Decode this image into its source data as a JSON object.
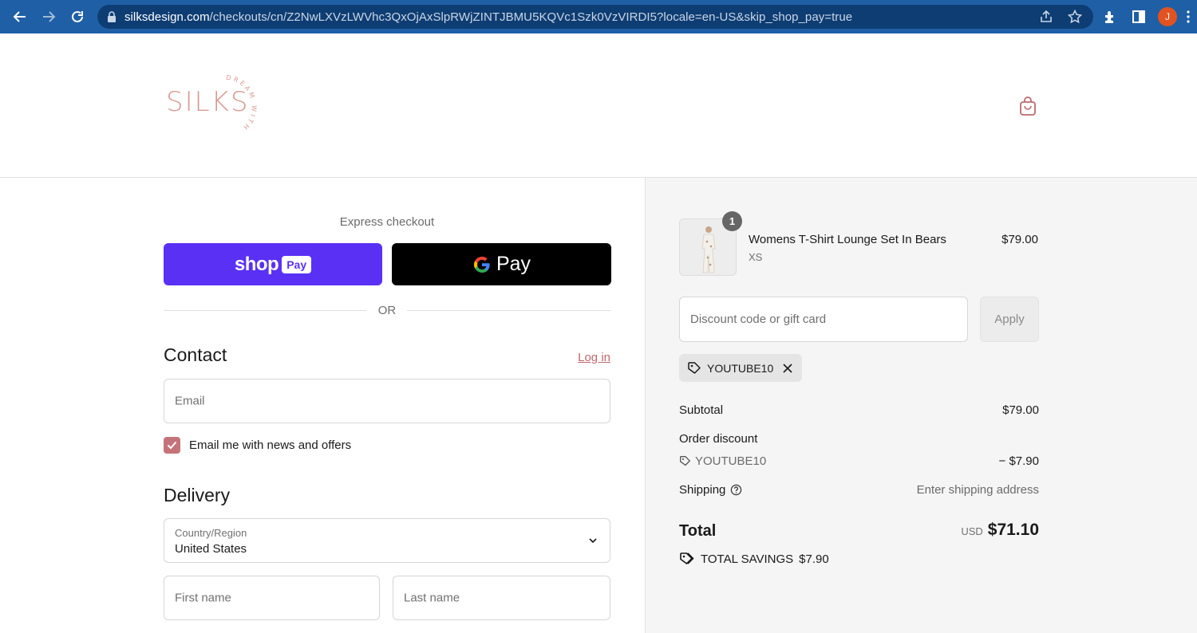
{
  "browser": {
    "url_host": "silksdesign.com",
    "url_path": "/checkouts/cn/Z2NwLXVzLWVhc3QxOjAxSlpRWjZINTJBMU5KQVc1Szk0VzVIRDI5?locale=en-US&skip_shop_pay=true",
    "avatar_initial": "J"
  },
  "header": {
    "logo_text": "SILKS",
    "logo_tagline": "DREAM WITH US"
  },
  "express": {
    "label": "Express checkout",
    "shop_word": "shop",
    "shop_pill": "Pay",
    "gpay_word": "Pay",
    "or": "OR"
  },
  "contact": {
    "title": "Contact",
    "login": "Log in",
    "email_placeholder": "Email",
    "newsletter_label": "Email me with news and offers",
    "newsletter_checked": true
  },
  "delivery": {
    "title": "Delivery",
    "country_label": "Country/Region",
    "country_value": "United States",
    "first_name_placeholder": "First name",
    "last_name_placeholder": "Last name"
  },
  "summary": {
    "item": {
      "quantity": "1",
      "name": "Womens T-Shirt Lounge Set In Bears",
      "variant": "XS",
      "price": "$79.00"
    },
    "discount_placeholder": "Discount code or gift card",
    "apply_label": "Apply",
    "applied_code": "YOUTUBE10",
    "subtotal_label": "Subtotal",
    "subtotal_value": "$79.00",
    "order_discount_label": "Order discount",
    "discount_code": "YOUTUBE10",
    "discount_value": "− $7.90",
    "shipping_label": "Shipping",
    "shipping_value": "Enter shipping address",
    "total_label": "Total",
    "total_currency": "USD",
    "total_value": "$71.10",
    "savings_label": "TOTAL SAVINGS",
    "savings_value": "$7.90"
  },
  "colors": {
    "browser_bar": "#1f5fa6",
    "shop_pay": "#5a31f4",
    "accent": "#c47479",
    "logo": "#d79a92"
  }
}
